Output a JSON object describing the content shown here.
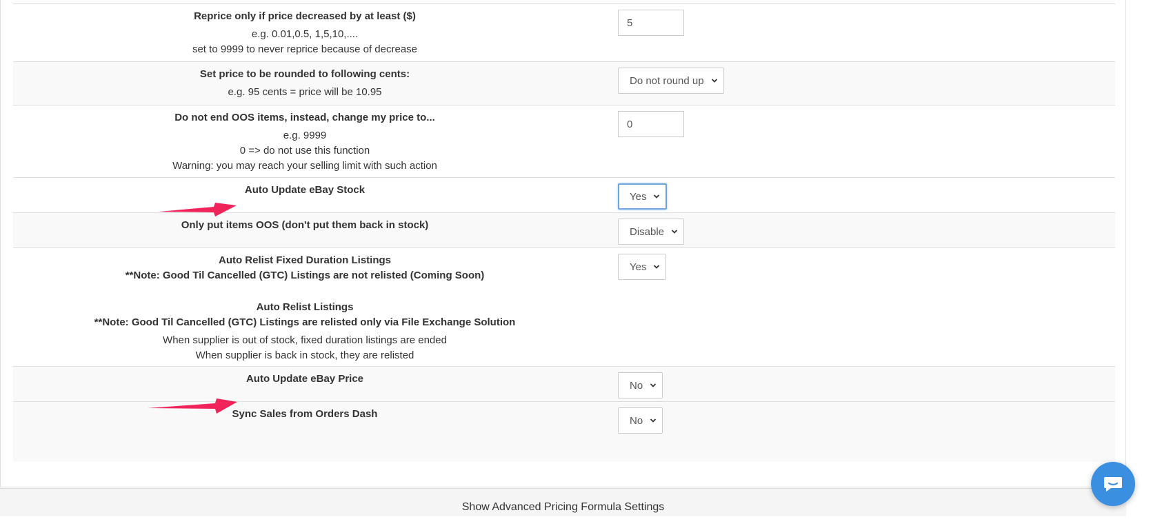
{
  "settings": {
    "reprice_decrease": {
      "title": "Reprice only if price decreased by at least ($)",
      "desc": [
        "e.g. 0.01,0.5, 1,5,10,....",
        "set to 9999 to never reprice because of decrease"
      ],
      "value": "5"
    },
    "round_cents": {
      "title": "Set price to be rounded to following cents:",
      "desc": [
        "e.g. 95 cents = price will be 10.95"
      ],
      "value": "Do not round up"
    },
    "oos_price": {
      "title": "Do not end OOS items, instead, change my price to...",
      "desc": [
        "e.g. 9999",
        "0 => do not use this function",
        "Warning: you may reach your selling limit with such action"
      ],
      "value": "0"
    },
    "auto_update_stock": {
      "title": "Auto Update eBay Stock",
      "value": "Yes"
    },
    "only_oos": {
      "title": "Only put items OOS (don't put them back in stock)",
      "value": "Disable"
    },
    "auto_relist_fixed": {
      "title": "Auto Relist Fixed Duration Listings",
      "note": "**Note: Good Til Cancelled (GTC) Listings are not relisted (Coming Soon)",
      "value": "Yes"
    },
    "auto_relist": {
      "title": "Auto Relist Listings",
      "note": "**Note: Good Til Cancelled (GTC) Listings are relisted only via File Exchange Solution",
      "desc": [
        "When supplier is out of stock, fixed duration listings are ended",
        "When supplier is back in stock, they are relisted"
      ]
    },
    "auto_update_price": {
      "title": "Auto Update eBay Price",
      "value": "No"
    },
    "sync_sales": {
      "title": "Sync Sales from Orders Dash",
      "value": "No"
    }
  },
  "footer": {
    "label": "Show Advanced Pricing Formula Settings"
  },
  "icons": {
    "chevron": "chevron-down-icon",
    "arrow": "arrow-right-icon",
    "chat": "chat-icon"
  },
  "colors": {
    "arrow": "#f0245a",
    "chat": "#3b8fe0",
    "focus": "#6ea4e0"
  }
}
